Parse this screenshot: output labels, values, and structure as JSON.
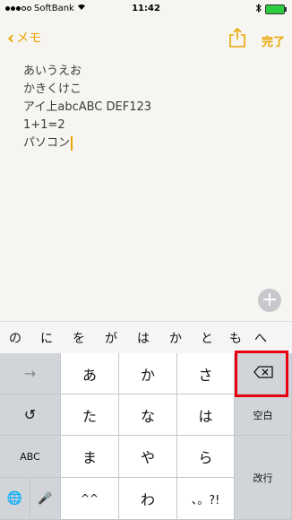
{
  "status_bar": {
    "carrier": "SoftBank",
    "time": "11:42",
    "signal_filled": 3,
    "signal_total": 5
  },
  "nav": {
    "back_label": "メモ",
    "done_label": "完了",
    "share_icon": "share-icon"
  },
  "note": {
    "lines": [
      "あいうえお",
      "かきくけこ",
      "アイ上abcABC  DEF123",
      "1+1=2",
      "パソコン"
    ]
  },
  "suggestions": [
    "の",
    "に",
    "を",
    "が",
    "は",
    "か",
    "と",
    "も",
    "へ"
  ],
  "keyboard": {
    "row1": [
      "→",
      "あ",
      "か",
      "さ",
      "⌫"
    ],
    "row2": [
      "↺",
      "た",
      "な",
      "は",
      "空白"
    ],
    "row3": [
      "ABC",
      "ま",
      "や",
      "ら",
      "改行"
    ],
    "row4": [
      "🌐",
      "🎤",
      "^^",
      "わ",
      "、。?!"
    ]
  },
  "colors": {
    "accent": "#e8a700",
    "highlight": "#e8000f",
    "key_white": "#ffffff",
    "key_gray": "#d1d4d9"
  }
}
